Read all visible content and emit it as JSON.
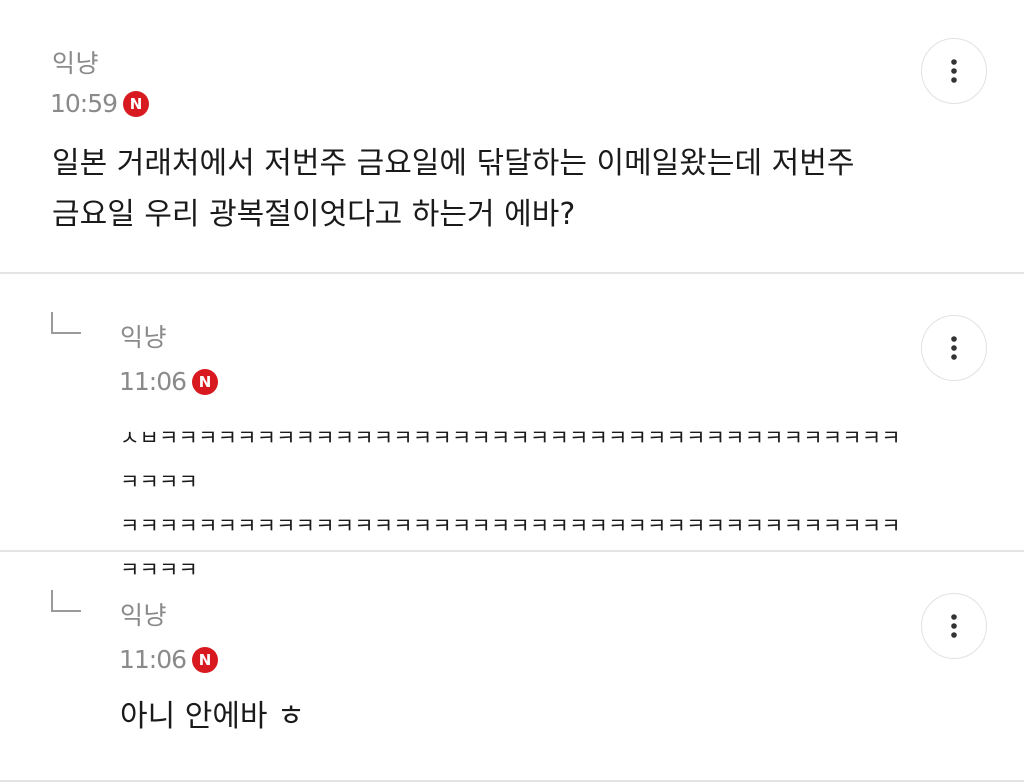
{
  "comments": [
    {
      "author": "익냥",
      "time": "10:59",
      "badge": "N",
      "text": "일본 거래처에서 저번주 금요일에 닦달하는 이메일왔는데 저번주\n금요일 우리 광복절이엇다고 하는거 에바?"
    },
    {
      "author": "익냥",
      "time": "11:06",
      "badge": "N",
      "text": "ㅅㅂㅋㅋㅋㅋㅋㅋㅋㅋㅋㅋㅋㅋㅋㅋㅋㅋㅋㅋㅋㅋㅋㅋㅋㅋㅋㅋㅋㅋㅋㅋㅋㅋㅋㅋㅋㅋㅋㅋㅋㅋㅋㅋ\nㅋㅋㅋㅋㅋㅋㅋㅋㅋㅋㅋㅋㅋㅋㅋㅋㅋㅋㅋㅋㅋㅋㅋㅋㅋㅋㅋㅋㅋㅋㅋㅋㅋㅋㅋㅋㅋㅋㅋㅋㅋㅋㅋㅋ"
    },
    {
      "author": "익냥",
      "time": "11:06",
      "badge": "N",
      "text": "아니 안에바 ㅎ"
    }
  ],
  "icons": {
    "more": "vertical-ellipsis-icon",
    "reply": "reply-arrow-icon",
    "new": "new-badge-icon"
  },
  "colors": {
    "badge": "#d8191f",
    "meta": "#8a8a8a",
    "divider": "#e4e4e4"
  }
}
